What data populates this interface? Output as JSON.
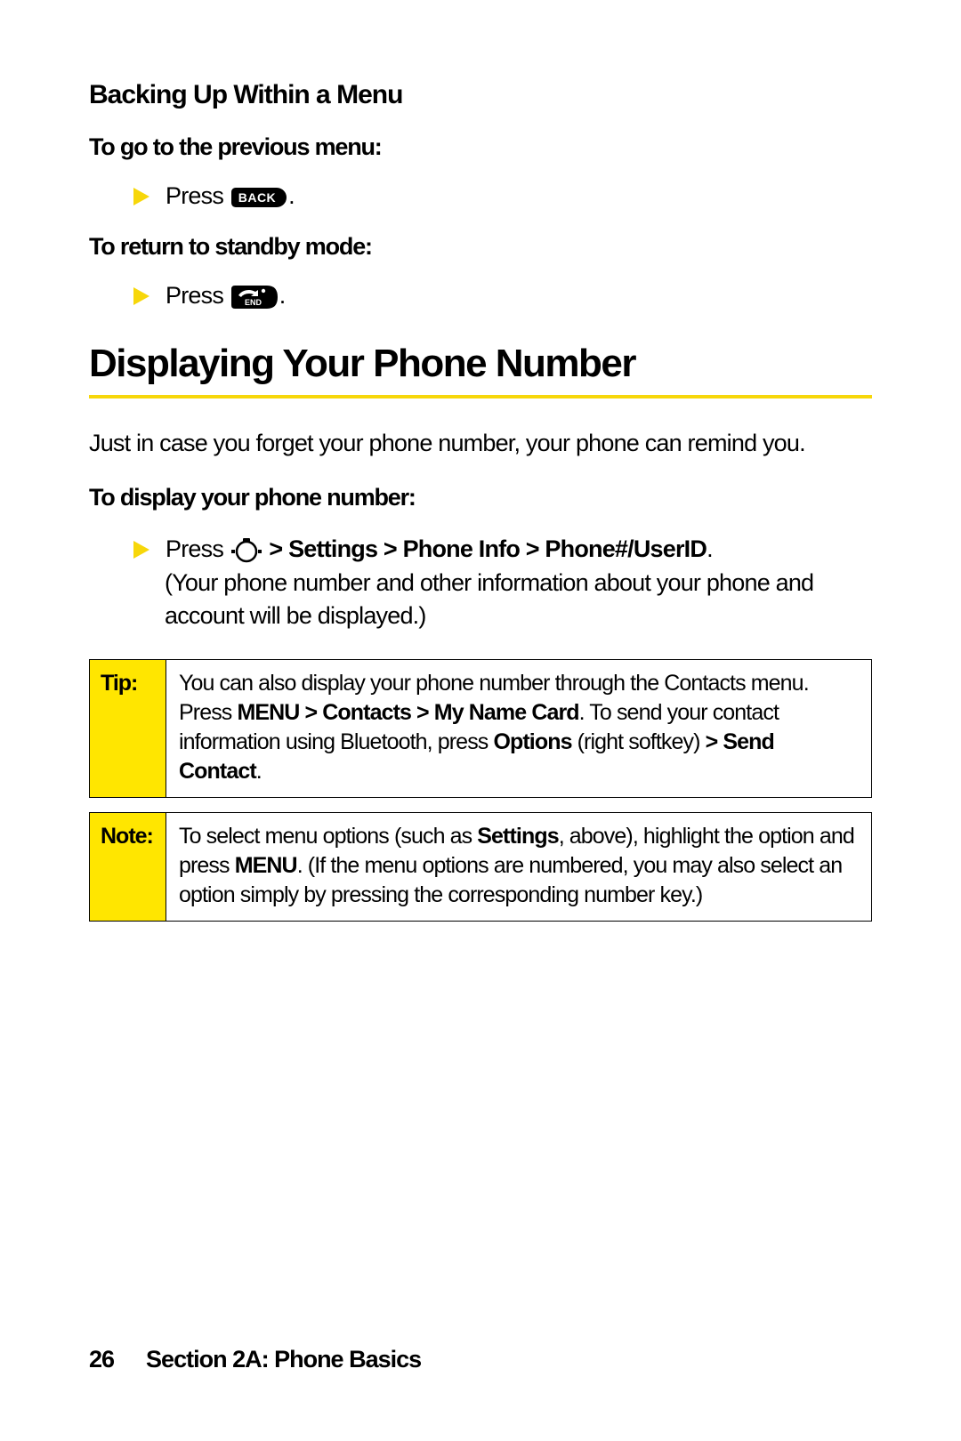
{
  "section1": {
    "heading": "Backing Up Within a Menu",
    "lead1": "To go to the previous menu:",
    "step1_press": "Press ",
    "back_key_label": "BACK",
    "lead2": "To return to standby mode:",
    "step2_press": "Press "
  },
  "section2": {
    "heading": "Displaying Your Phone Number",
    "intro": "Just in case you forget your phone number, your phone can remind you.",
    "lead": "To display your phone number:",
    "step_press": "Press ",
    "step_path": "> Settings > Phone Info > Phone#/UserID",
    "step_period": ".",
    "step_note": "(Your phone number and other information about your phone and account will be displayed.)"
  },
  "tip": {
    "label": "Tip:",
    "t1": "You can also display your phone number through the Contacts menu. Press ",
    "b1": "MENU > Contacts > My Name Card",
    "t2": ". To send your contact information using Bluetooth, press ",
    "b2": "Options",
    "t3": " (right softkey) ",
    "b3": "> Send Contact",
    "t4": "."
  },
  "note": {
    "label": "Note:",
    "t1": "To select menu options (such as ",
    "b1": "Settings",
    "t2": ", above), highlight the option and press ",
    "b2": "MENU",
    "t3": ". (If the menu options are numbered, you may also select an option simply by pressing the corresponding number key.)"
  },
  "footer": {
    "page": "26",
    "section": "Section 2A: Phone Basics"
  }
}
